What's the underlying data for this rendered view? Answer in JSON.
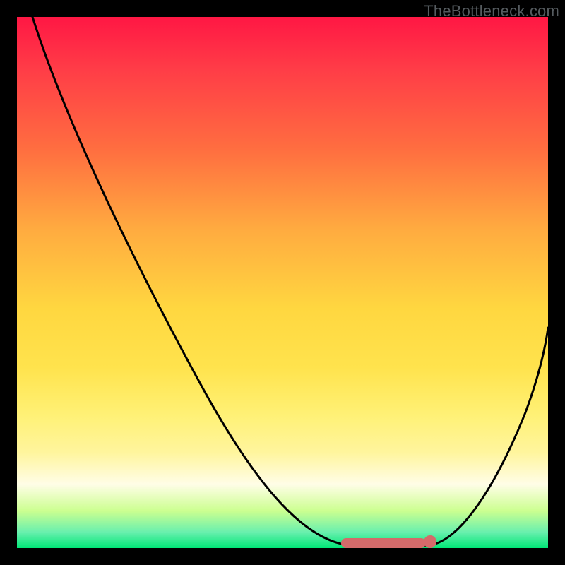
{
  "watermark": "TheBottleneck.com",
  "colors": {
    "page_bg": "#000000",
    "watermark": "#555b5f",
    "curve": "#000000",
    "marker": "#d46a6a"
  },
  "chart_data": {
    "type": "line",
    "title": "",
    "xlabel": "",
    "ylabel": "",
    "xlim": [
      0,
      100
    ],
    "ylim": [
      0,
      100
    ],
    "grid": false,
    "legend": false,
    "background": "red-to-green vertical gradient (bottleneck severity scale)",
    "series": [
      {
        "name": "bottleneck-curve",
        "x": [
          3,
          10,
          20,
          30,
          40,
          50,
          58,
          62,
          66,
          70,
          74,
          78,
          82,
          88,
          94,
          100
        ],
        "y": [
          100,
          88,
          72,
          56,
          40,
          24,
          10,
          4,
          1,
          0,
          0,
          0,
          1,
          8,
          22,
          44
        ]
      }
    ],
    "annotations": [
      {
        "kind": "optimal-range-marker",
        "x_start": 62,
        "x_end": 79,
        "y": 0,
        "color": "#d46a6a"
      }
    ]
  }
}
